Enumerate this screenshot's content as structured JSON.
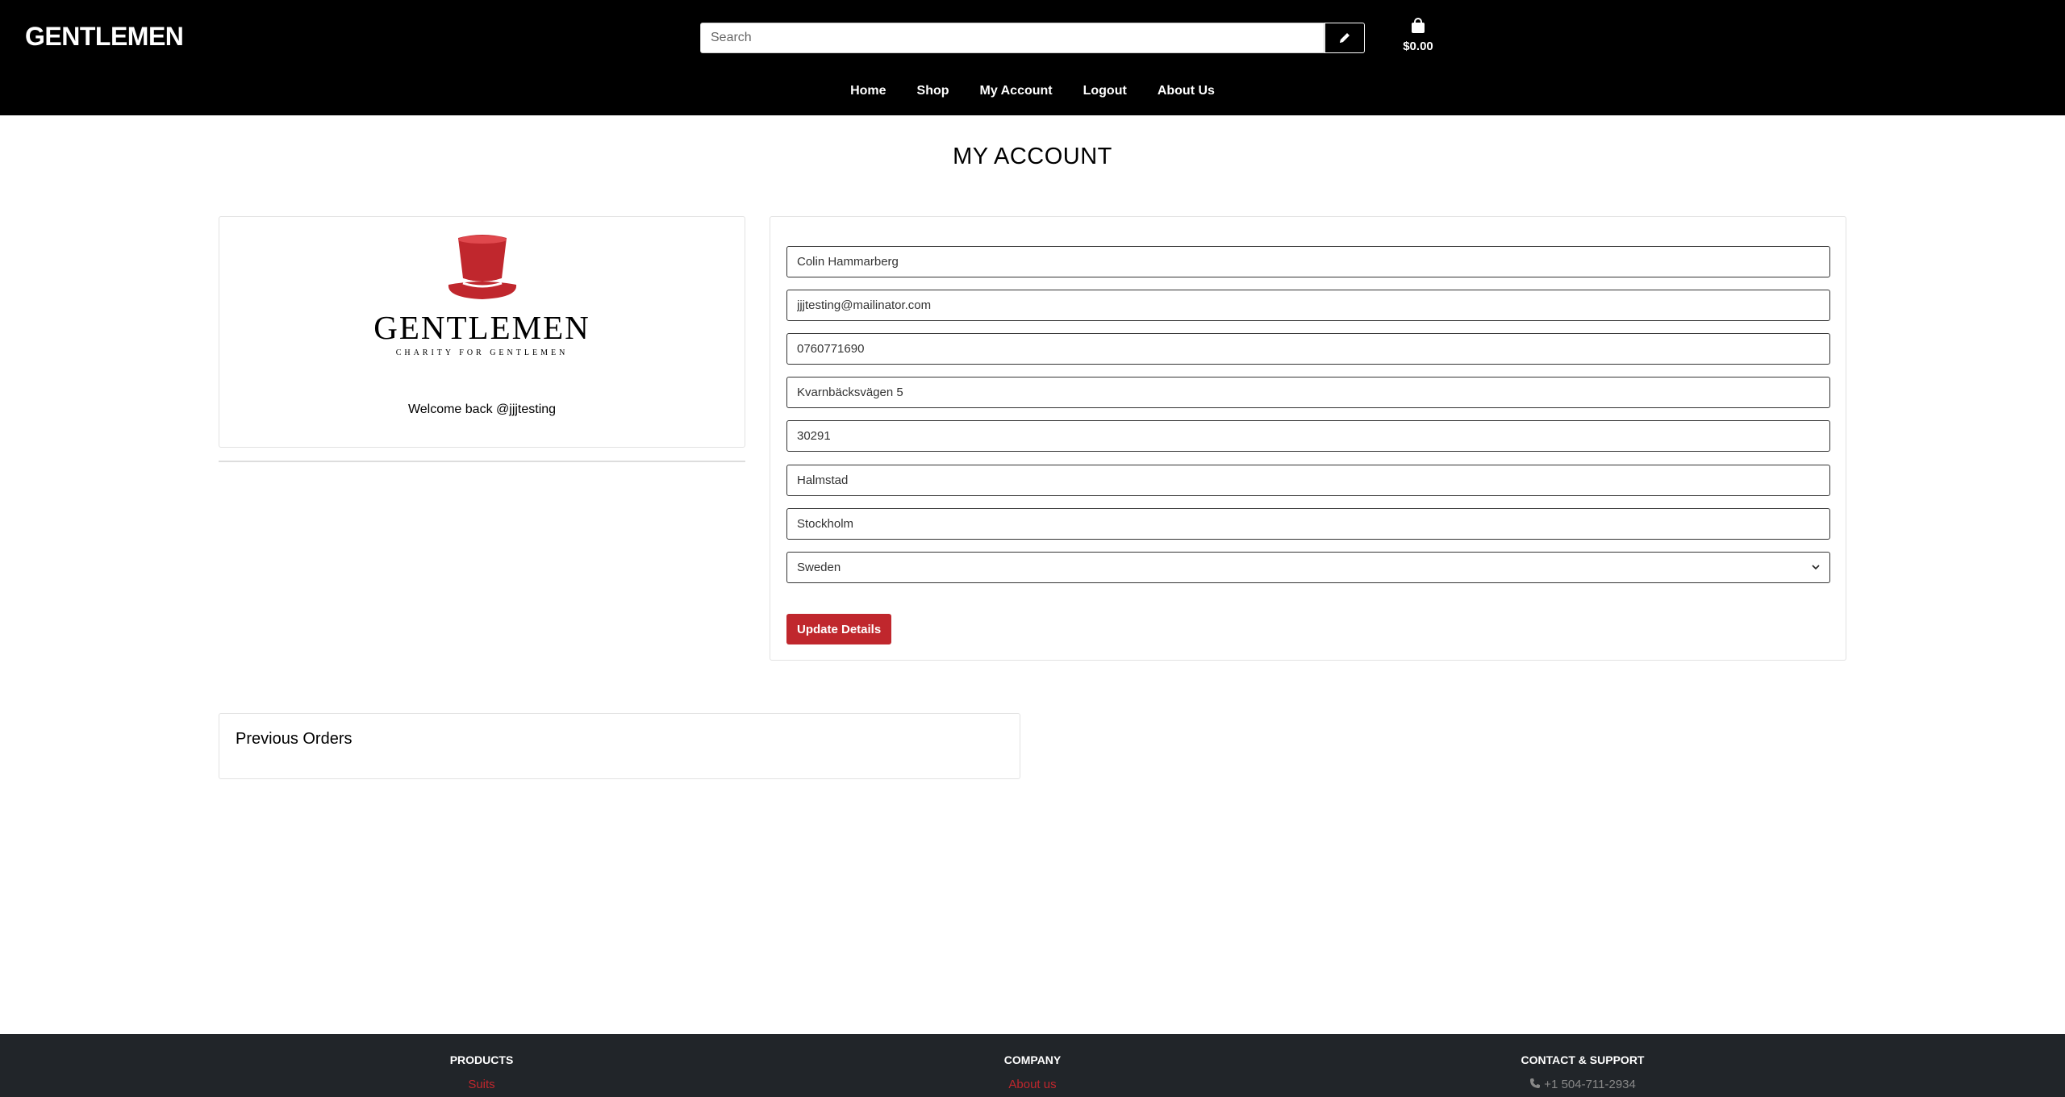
{
  "header": {
    "brand": "GENTLEMEN",
    "search_placeholder": "Search",
    "cart_total": "$0.00",
    "nav": [
      "Home",
      "Shop",
      "My Account",
      "Logout",
      "About Us"
    ]
  },
  "page": {
    "title": "MY ACCOUNT"
  },
  "profile": {
    "logo_word": "GENTLEMEN",
    "logo_tagline": "CHARITY FOR GENTLEMEN",
    "welcome": "Welcome back @jjjtesting"
  },
  "details": {
    "full_name": "Colin Hammarberg",
    "email": "jjjtesting@mailinator.com",
    "phone": "0760771690",
    "street": "Kvarnbäcksvägen 5",
    "postcode": "30291",
    "city": "Halmstad",
    "county": "Stockholm",
    "country": "Sweden",
    "update_label": "Update Details"
  },
  "orders": {
    "title": "Previous Orders"
  },
  "footer": {
    "products_head": "PRODUCTS",
    "products_link": "Suits",
    "company_head": "COMPANY",
    "company_link": "About us",
    "contact_head": "CONTACT & SUPPORT",
    "phone": "+1 504-711-2934"
  },
  "colors": {
    "accent": "#c0272d",
    "header_bg": "#000000",
    "footer_bg": "#212529"
  },
  "icons": {
    "search_button": "pencil-icon",
    "cart": "shopping-bag-icon",
    "phone": "phone-icon"
  }
}
